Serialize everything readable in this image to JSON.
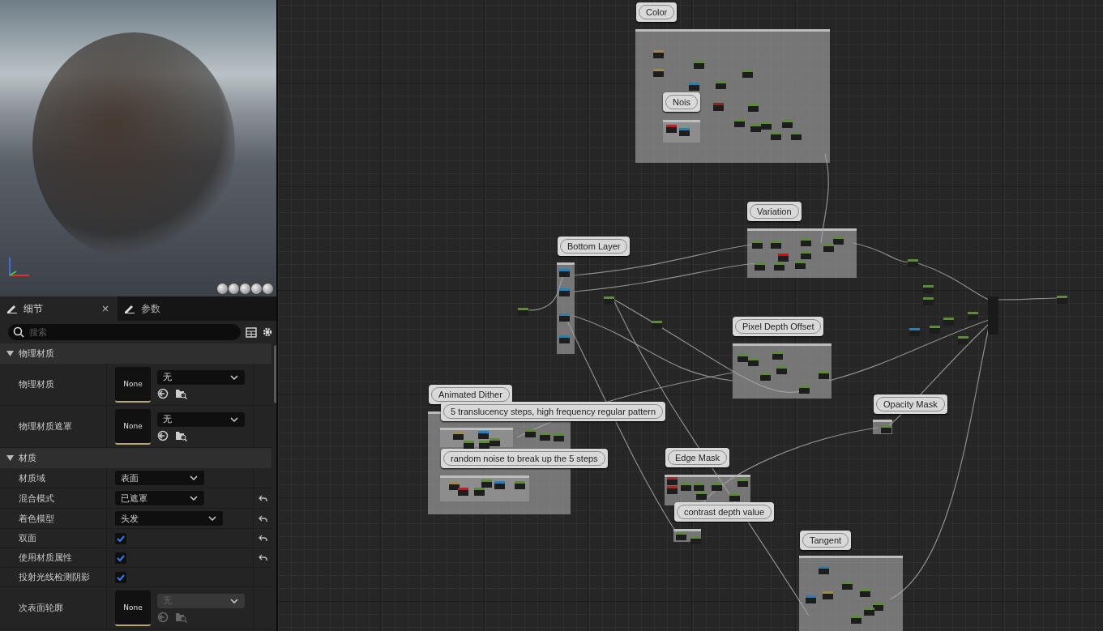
{
  "details": {
    "tabs": [
      {
        "label": "细节",
        "selected": true,
        "close": "×"
      },
      {
        "label": "参数",
        "selected": false
      }
    ],
    "search": {
      "placeholder": "搜索"
    },
    "sections": [
      {
        "title": "物理材质",
        "expanded": true,
        "rows": [
          {
            "kind": "asset",
            "label": "物理材质",
            "thumb": "None",
            "value": "无",
            "disabled": false
          },
          {
            "kind": "asset",
            "label": "物理材质遮罩",
            "thumb": "None",
            "value": "无",
            "disabled": false
          }
        ]
      },
      {
        "title": "材质",
        "expanded": true,
        "rows": [
          {
            "kind": "dropdown",
            "label": "材质域",
            "value": "表面",
            "reset": false
          },
          {
            "kind": "dropdown",
            "label": "混合模式",
            "value": "已遮罩",
            "reset": true
          },
          {
            "kind": "dropdown",
            "label": "着色模型",
            "value": "头发",
            "reset": true
          },
          {
            "kind": "checkbox",
            "label": "双面",
            "checked": true,
            "reset": true
          },
          {
            "kind": "checkbox",
            "label": "使用材质属性",
            "checked": true,
            "reset": true
          },
          {
            "kind": "checkbox",
            "label": "投射光线检测阴影",
            "checked": true,
            "reset": false
          },
          {
            "kind": "asset",
            "label": "次表面轮廓",
            "thumb": "None",
            "value": "无",
            "disabled": true
          }
        ]
      }
    ]
  },
  "graph": {
    "comments": [
      {
        "title": "Color"
      },
      {
        "title": "Nois"
      },
      {
        "title": "Variation"
      },
      {
        "title": "Bottom Layer"
      },
      {
        "title": "Pixel Depth Offset"
      },
      {
        "title": "Animated Dither"
      },
      {
        "title": "5 translucency steps, high frequency regular pattern"
      },
      {
        "title": "random noise to break up the 5 steps"
      },
      {
        "title": "Opacity Mask"
      },
      {
        "title": "Edge Mask"
      },
      {
        "title": "contrast depth value"
      },
      {
        "title": "Tangent"
      }
    ]
  }
}
